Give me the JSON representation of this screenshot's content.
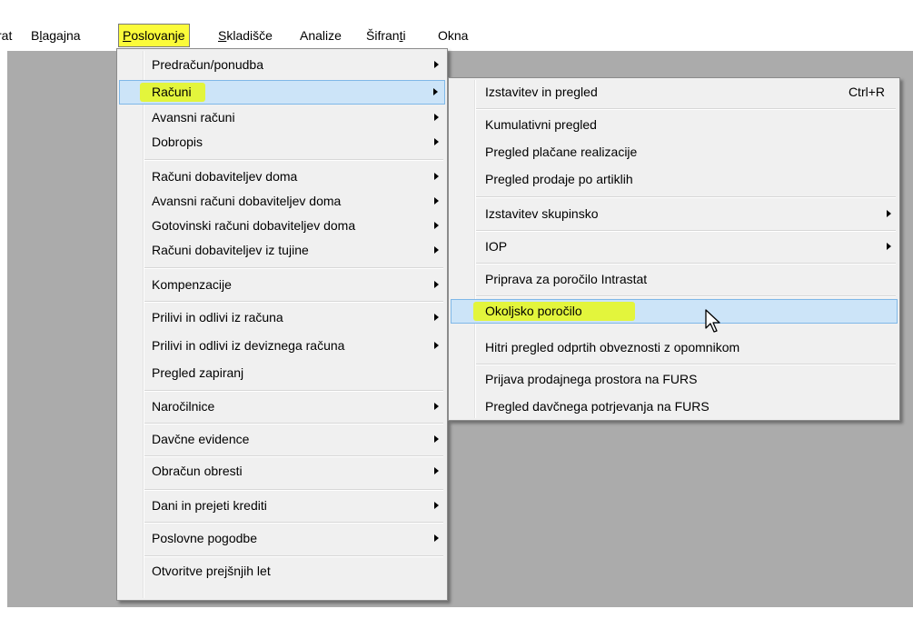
{
  "menubar": {
    "items": [
      {
        "label": "rat",
        "x": "first"
      },
      {
        "label_pre": "B",
        "label_acc": "l",
        "label_post": "agajna"
      },
      {
        "label_pre": "",
        "label_acc": "P",
        "label_post": "oslovanje"
      },
      {
        "label_pre": "",
        "label_acc": "S",
        "label_post": "kladišče"
      },
      {
        "label": "Analize"
      },
      {
        "label_pre": "Šifran",
        "label_acc": "t",
        "label_post": "i"
      },
      {
        "label": "Okna"
      }
    ]
  },
  "main_menu": {
    "items": [
      {
        "label": "Predračun/ponudba"
      },
      {
        "label": "Računi"
      },
      {
        "label": "Avansni računi"
      },
      {
        "label": "Dobropis"
      },
      {
        "label": "Računi dobaviteljev doma"
      },
      {
        "label": "Avansni računi dobaviteljev doma"
      },
      {
        "label": "Gotovinski računi dobaviteljev doma"
      },
      {
        "label": "Računi dobaviteljev iz tujine"
      },
      {
        "label": "Kompenzacije"
      },
      {
        "label": "Prilivi in odlivi iz računa"
      },
      {
        "label": "Prilivi in odlivi iz deviznega računa"
      },
      {
        "label": "Pregled zapiranj"
      },
      {
        "label": "Naročilnice"
      },
      {
        "label": "Davčne evidence"
      },
      {
        "label": "Obračun obresti"
      },
      {
        "label": "Dani in prejeti krediti"
      },
      {
        "label": "Poslovne pogodbe"
      },
      {
        "label": "Otvoritve prejšnjih let"
      }
    ]
  },
  "sub_menu": {
    "items": [
      {
        "label": "Izstavitev in pregled",
        "shortcut": "Ctrl+R"
      },
      {
        "label": "Kumulativni pregled"
      },
      {
        "label": "Pregled plačane realizacije"
      },
      {
        "label": "Pregled prodaje po artiklih"
      },
      {
        "label": "Izstavitev skupinsko"
      },
      {
        "label": "IOP"
      },
      {
        "label": "Priprava za poročilo Intrastat"
      },
      {
        "label": "Okoljsko poročilo"
      },
      {
        "label": "Hitri pregled odprtih obveznosti z opomnikom"
      },
      {
        "label": "Prijava prodajnega prostora na FURS"
      },
      {
        "label": "Pregled davčnega potrjevanja na FURS"
      }
    ]
  },
  "colors": {
    "highlight": "#cce4f8",
    "marker": "#e3f53c",
    "workspace": "#ababab"
  }
}
